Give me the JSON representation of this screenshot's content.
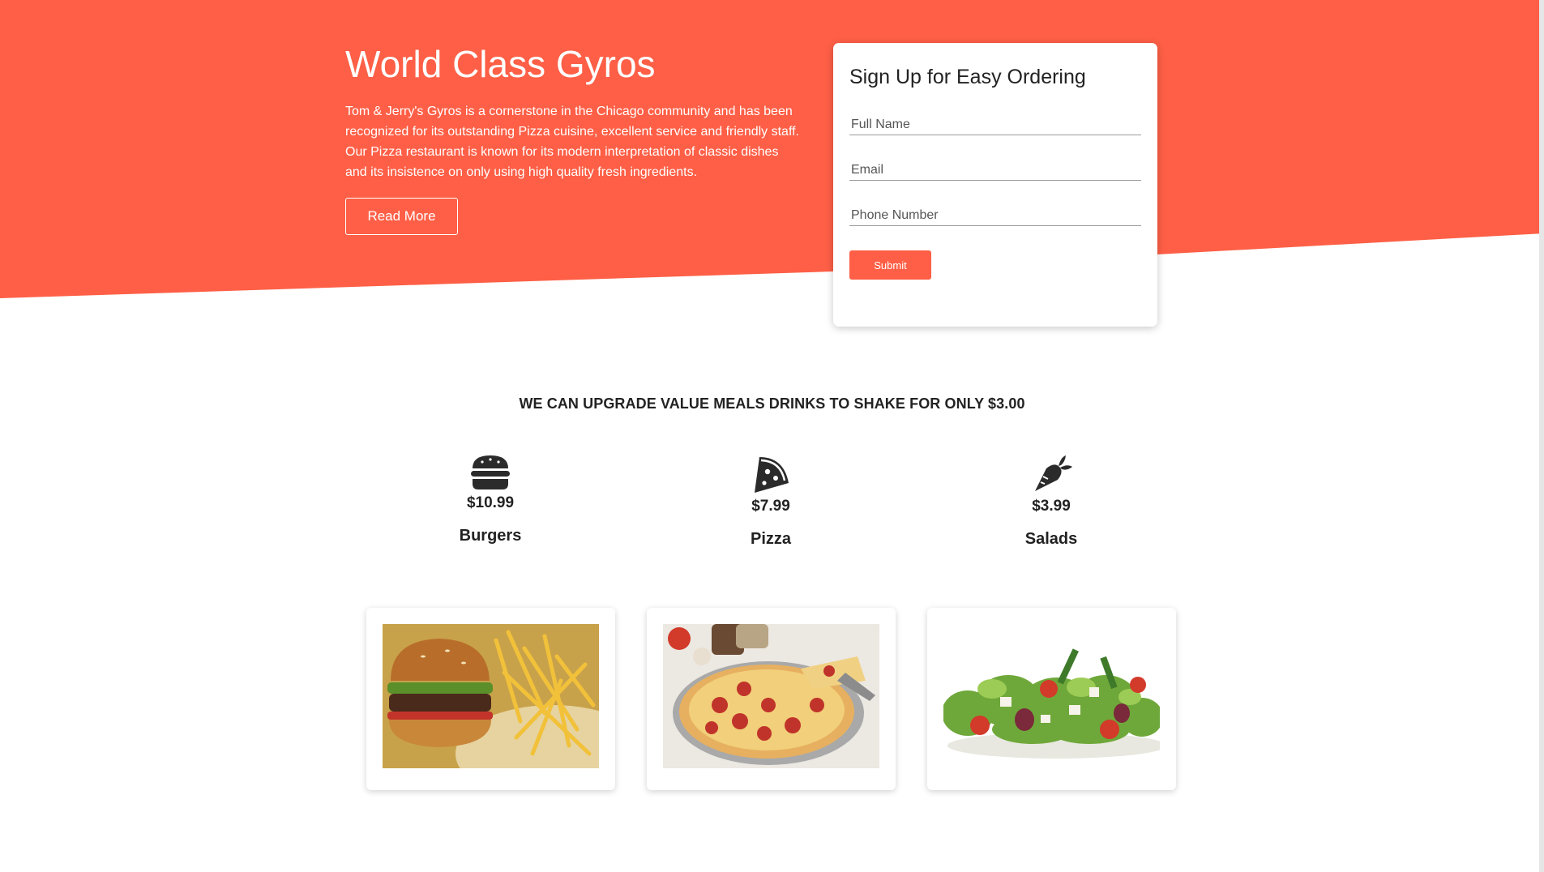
{
  "colors": {
    "accent": "#fe5f46",
    "text_dark": "#222222"
  },
  "hero": {
    "title": "World Class Gyros",
    "description": "Tom & Jerry's Gyros is a cornerstone in the Chicago community and has been recognized for its outstanding Pizza cuisine, excellent service and friendly staff. Our Pizza restaurant is known for its modern interpretation of classic dishes and its insistence on only using high quality fresh ingredients.",
    "read_more_label": "Read More"
  },
  "signup": {
    "title": "Sign Up for Easy Ordering",
    "full_name_placeholder": "Full Name",
    "email_placeholder": "Email",
    "phone_placeholder": "Phone Number",
    "submit_label": "Submit"
  },
  "promo": {
    "text": "WE CAN UPGRADE VALUE MEALS DRINKS TO SHAKE FOR ONLY $3.00"
  },
  "menu": {
    "items": [
      {
        "icon": "burger-icon",
        "price": "$10.99",
        "name": "Burgers"
      },
      {
        "icon": "pizza-slice-icon",
        "price": "$7.99",
        "name": "Pizza"
      },
      {
        "icon": "carrot-icon",
        "price": "$3.99",
        "name": "Salads"
      }
    ]
  },
  "photos": [
    {
      "subject": "burger-and-fries-photo"
    },
    {
      "subject": "pepperoni-pizza-photo"
    },
    {
      "subject": "greek-salad-photo"
    }
  ]
}
